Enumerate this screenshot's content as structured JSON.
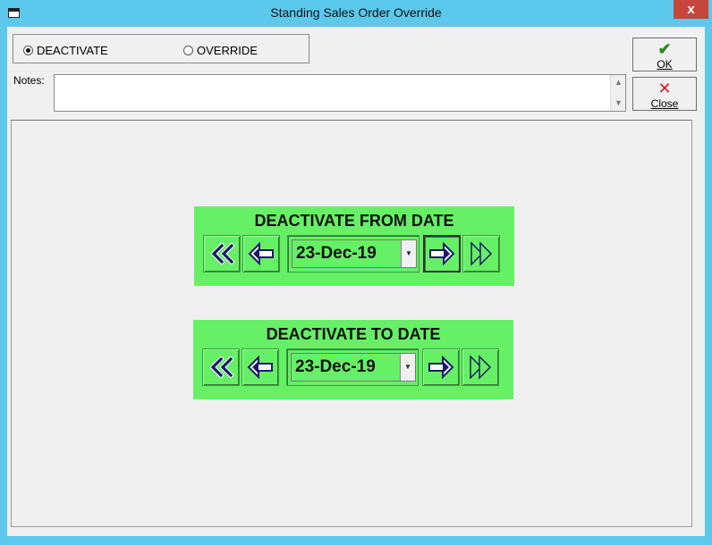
{
  "window": {
    "title": "Standing Sales Order Override",
    "close_glyph": "x"
  },
  "mode": {
    "options": [
      {
        "label": "DEACTIVATE",
        "selected": true
      },
      {
        "label": "OVERRIDE",
        "selected": false
      }
    ]
  },
  "notes": {
    "label": "Notes:",
    "value": ""
  },
  "buttons": {
    "ok": {
      "label": "OK",
      "icon": "check-icon"
    },
    "close": {
      "label": "Close",
      "icon": "x-icon"
    }
  },
  "from_date": {
    "title": "DEACTIVATE FROM DATE",
    "value": "23-Dec-19"
  },
  "to_date": {
    "title": "DEACTIVATE TO DATE",
    "value": "23-Dec-19"
  },
  "colors": {
    "titlebar": "#5bc8ec",
    "date_panel": "#66f066",
    "close_button": "#c7463c"
  }
}
